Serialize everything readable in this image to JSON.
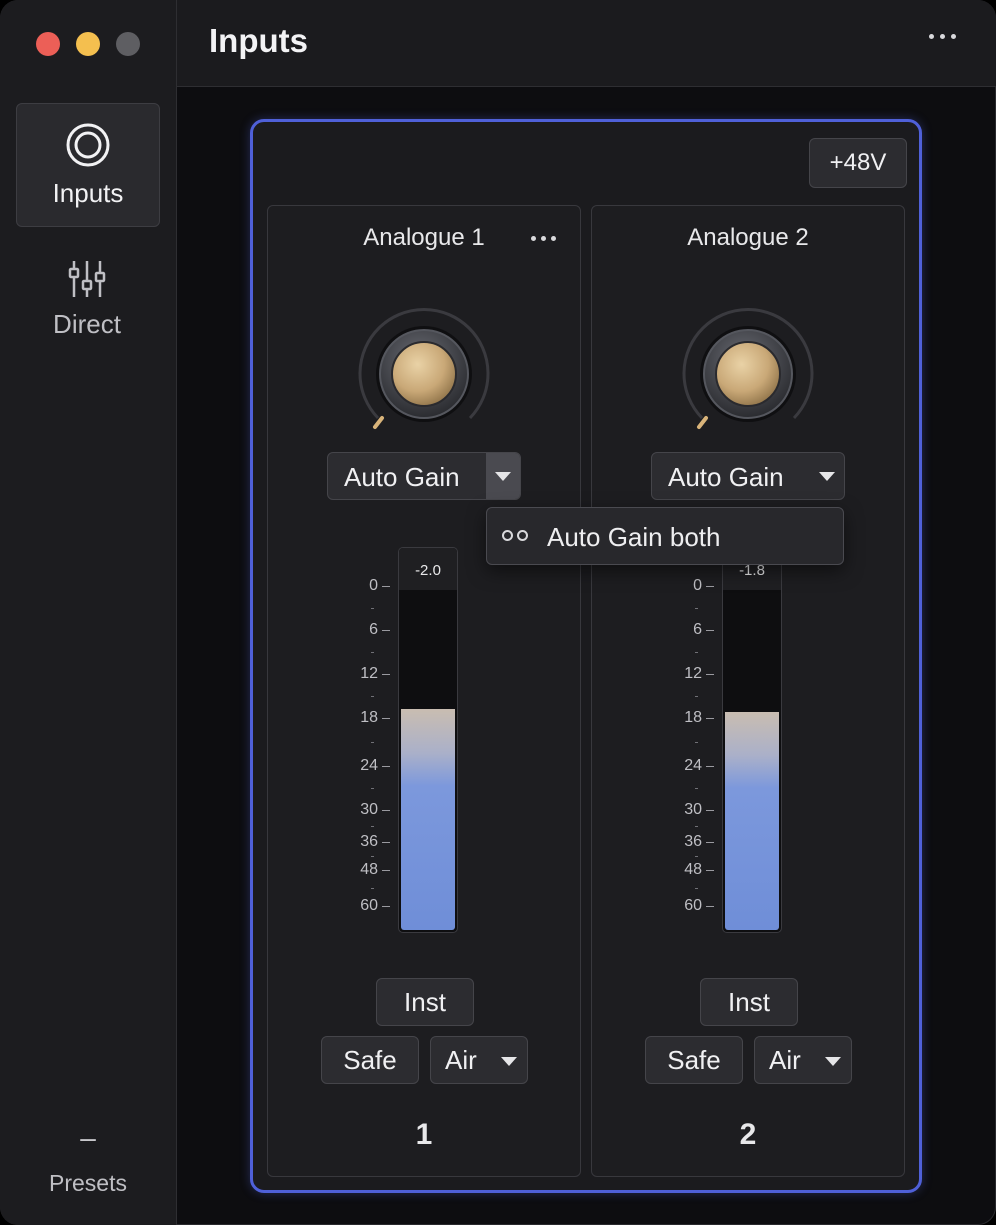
{
  "window": {
    "controls": [
      "close",
      "minimize",
      "zoom"
    ],
    "title": "Inputs"
  },
  "sidebar": {
    "items": [
      {
        "label": "Inputs",
        "icon": "inputs-rings-icon",
        "selected": true
      },
      {
        "label": "Direct",
        "icon": "mixer-sliders-icon",
        "selected": false
      }
    ],
    "presets_dash": "–",
    "presets_label": "Presets"
  },
  "header": {
    "more_icon": "more-horizontal-icon"
  },
  "device": {
    "phantom_power_label": "+48V",
    "accent_color": "#4f60d8",
    "channels": [
      {
        "name": "Analogue 1",
        "auto_gain_label": "Auto Gain",
        "peak_label": "-2.0",
        "level_fraction": 0.65,
        "inst_label": "Inst",
        "safe_label": "Safe",
        "air_label": "Air",
        "number": "1"
      },
      {
        "name": "Analogue 2",
        "auto_gain_label": "Auto Gain",
        "peak_label": "-1.8",
        "level_fraction": 0.64,
        "inst_label": "Inst",
        "safe_label": "Safe",
        "air_label": "Air",
        "number": "2"
      }
    ],
    "meter_scale": [
      "0",
      "6",
      "12",
      "18",
      "24",
      "30",
      "36",
      "48",
      "60"
    ]
  },
  "popup": {
    "item_label": "Auto Gain both",
    "icon": "linked-rings-icon"
  }
}
